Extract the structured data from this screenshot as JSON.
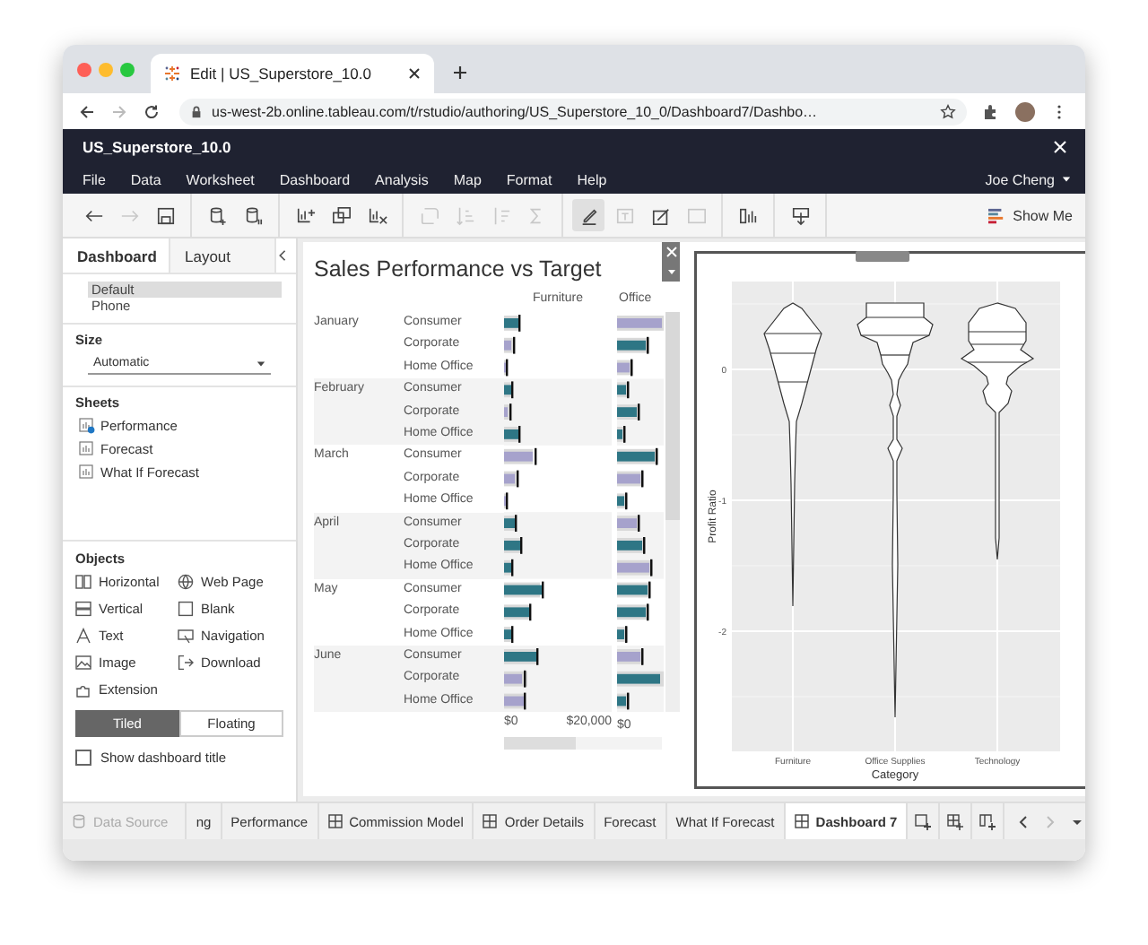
{
  "browser": {
    "tab_title": "Edit | US_Superstore_10.0",
    "url": "us-west-2b.online.tableau.com/t/rstudio/authoring/US_Superstore_10_0/Dashboard7/Dashbo…"
  },
  "app": {
    "title": "US_Superstore_10.0",
    "menu": [
      "File",
      "Data",
      "Worksheet",
      "Dashboard",
      "Analysis",
      "Map",
      "Format",
      "Help"
    ],
    "user": "Joe Cheng"
  },
  "toolbar": [
    [
      {
        "disabled": false,
        "active": false
      },
      {
        "disabled": true,
        "active": false
      },
      {
        "disabled": false,
        "active": false
      }
    ],
    [
      {
        "disabled": false,
        "active": false
      },
      {
        "disabled": false,
        "active": false
      }
    ],
    [
      {
        "disabled": false,
        "active": false
      },
      {
        "disabled": false,
        "active": false
      },
      {
        "disabled": false,
        "active": false
      }
    ],
    [
      {
        "disabled": true,
        "active": false
      },
      {
        "disabled": true,
        "active": false
      },
      {
        "disabled": true,
        "active": false
      },
      {
        "disabled": true,
        "active": false
      }
    ],
    [
      {
        "disabled": false,
        "active": true
      },
      {
        "disabled": true,
        "active": false
      },
      {
        "disabled": false,
        "active": false
      },
      {
        "disabled": true,
        "active": false
      }
    ],
    [
      {
        "disabled": false,
        "active": false
      }
    ],
    [
      {
        "disabled": false,
        "active": false
      }
    ]
  ],
  "show_me": "Show Me",
  "side_tabs": [
    {
      "label": "Dashboard",
      "selected": true
    },
    {
      "label": "Layout",
      "selected": false
    }
  ],
  "devices": [
    {
      "label": "Default",
      "selected": true
    },
    {
      "label": "Phone",
      "selected": false
    }
  ],
  "size": {
    "heading": "Size",
    "value": "Automatic"
  },
  "sheets": {
    "heading": "Sheets",
    "items": [
      {
        "label": "Performance",
        "used": true
      },
      {
        "label": "Forecast",
        "used": false
      },
      {
        "label": "What If Forecast",
        "used": false
      }
    ]
  },
  "objects": {
    "heading": "Objects",
    "items": [
      {
        "label": "Horizontal"
      },
      {
        "label": "Web Page"
      },
      {
        "label": "Vertical"
      },
      {
        "label": "Blank"
      },
      {
        "label": "Text"
      },
      {
        "label": "Navigation"
      },
      {
        "label": "Image"
      },
      {
        "label": "Download"
      },
      {
        "label": "Extension"
      }
    ]
  },
  "layout_mode": [
    {
      "label": "Tiled",
      "selected": true
    },
    {
      "label": "Floating",
      "selected": false
    }
  ],
  "show_title": {
    "label": "Show dashboard title",
    "checked": false
  },
  "dashboard": {
    "title": "Sales Performance vs Target",
    "columns": [
      "Furniture",
      "Office"
    ],
    "months": [
      {
        "label": "January",
        "segments": [
          "Consumer",
          "Corporate",
          "Home Office"
        ]
      },
      {
        "label": "February",
        "segments": [
          "Consumer",
          "Corporate",
          "Home Office"
        ]
      },
      {
        "label": "March",
        "segments": [
          "Consumer",
          "Corporate",
          "Home Office"
        ]
      },
      {
        "label": "April",
        "segments": [
          "Consumer",
          "Corporate",
          "Home Office"
        ]
      },
      {
        "label": "May",
        "segments": [
          "Consumer",
          "Corporate",
          "Home Office"
        ]
      },
      {
        "label": "June",
        "segments": [
          "Consumer",
          "Corporate",
          "Home Office"
        ]
      }
    ],
    "axis_labels": [
      "$0",
      "$20,000",
      "$0"
    ]
  },
  "violin": {
    "ylabel": "Profit Ratio",
    "xlabel": "Category",
    "categories": [
      "Furniture",
      "Office Supplies",
      "Technology"
    ],
    "yticks": [
      "0",
      "-1",
      "-2"
    ]
  },
  "sheet_tabs": [
    {
      "label": "Data Source",
      "kind": "datasource",
      "selected": false
    },
    {
      "label": "ng",
      "kind": "sheet",
      "selected": false
    },
    {
      "label": "Performance",
      "kind": "sheet",
      "selected": false
    },
    {
      "label": "Commission Model",
      "kind": "dashboard",
      "selected": false
    },
    {
      "label": "Order Details",
      "kind": "dashboard",
      "selected": false
    },
    {
      "label": "Forecast",
      "kind": "sheet",
      "selected": false
    },
    {
      "label": "What If Forecast",
      "kind": "sheet",
      "selected": false
    },
    {
      "label": "Dashboard 7",
      "kind": "dashboard",
      "selected": true
    }
  ]
}
